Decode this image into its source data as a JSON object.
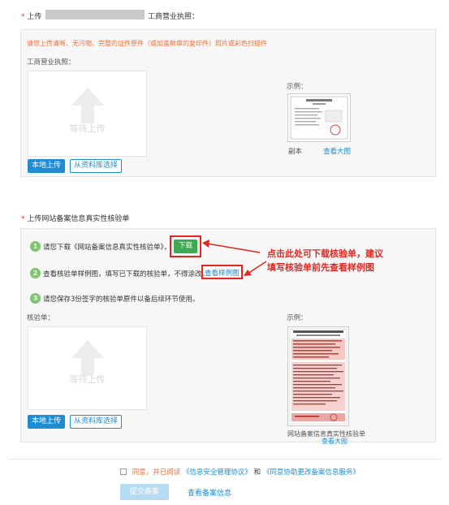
{
  "section1": {
    "required_mark": "*",
    "title_prefix": "上传",
    "title_suffix": "工商营业执照：",
    "notice": "请您上传清晰、无污物、完整的证件原件（或加盖鲜章的复印件）照片或彩色扫描件",
    "field_label": "工商营业执照：",
    "placeholder_text": "等待上传",
    "example_label": "示例：",
    "sample_caption": "副本",
    "view_large": "查看大图",
    "local_upload_button": "本地上传",
    "library_button": "从资料库选择"
  },
  "section2": {
    "required_mark": "*",
    "title": "上传网站备案信息真实性核验单",
    "steps": [
      {
        "num": "1",
        "text": "请您下载《网站备案信息真实性核验单》，",
        "action": "下载"
      },
      {
        "num": "2",
        "text": "查看核验单样例图，填写已下载的核验单，不得涂改。",
        "action": "查看样例图"
      },
      {
        "num": "3",
        "text": "请您保存3份签字的核验单原件以备后续环节使用。"
      }
    ],
    "annotation_line1": "点击此处可下载核验单，建议",
    "annotation_line2": "填写核验单前先查看样例图",
    "field_label": "核验单：",
    "placeholder_text": "等待上传",
    "example_label": "示例：",
    "sample_caption": "网站备案信息真实性核验单",
    "view_large": "查看大图",
    "local_upload_button": "本地上传",
    "library_button": "从资料库选择"
  },
  "footer": {
    "agree_prefix": "同意，并已阅读",
    "agreement1": "《信息安全管理协议》",
    "and": "和",
    "agreement2": "《同意协助更改备案信息服务》",
    "submit_button": "提交备案",
    "view_info_link": "查看备案信息"
  },
  "colors": {
    "primary": "#1f8bd2",
    "download_green": "#3caa4f",
    "highlight_red": "#e4261f",
    "notice_orange": "#e8733a"
  }
}
